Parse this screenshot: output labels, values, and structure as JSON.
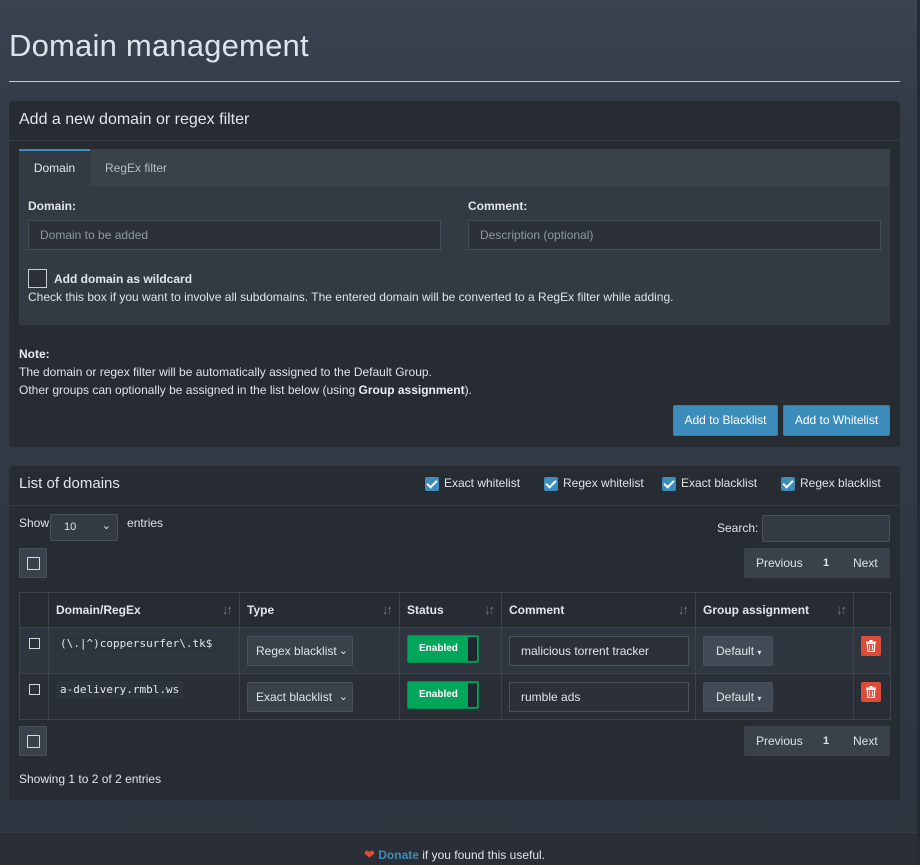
{
  "page": {
    "title": "Domain management"
  },
  "add_box": {
    "title": "Add a new domain or regex filter",
    "tabs": [
      "Domain",
      "RegEx filter"
    ],
    "domain_label": "Domain:",
    "domain_placeholder": "Domain to be added",
    "comment_label": "Comment:",
    "comment_placeholder": "Description (optional)",
    "wildcard_label": "Add domain as wildcard",
    "wildcard_help": "Check this box if you want to involve all subdomains. The entered domain will be converted to a RegEx filter while adding.",
    "note_title": "Note:",
    "note_line1": "The domain or regex filter will be automatically assigned to the Default Group.",
    "note_line2_pre": "Other groups can optionally be assigned in the list below (using ",
    "note_line2_bold": "Group assignment",
    "note_line2_post": ").",
    "btn_blacklist": "Add to Blacklist",
    "btn_whitelist": "Add to Whitelist"
  },
  "list_box": {
    "title": "List of domains",
    "filters": [
      {
        "label": "Exact whitelist",
        "checked": true
      },
      {
        "label": "Regex whitelist",
        "checked": true
      },
      {
        "label": "Exact blacklist",
        "checked": true
      },
      {
        "label": "Regex blacklist",
        "checked": true
      }
    ],
    "show_label": "Show",
    "entries_label": "entries",
    "page_length": "10",
    "search_label": "Search:",
    "pager": {
      "prev": "Previous",
      "page": "1",
      "next": "Next"
    },
    "columns": [
      "Domain/RegEx",
      "Type",
      "Status",
      "Comment",
      "Group assignment"
    ],
    "rows": [
      {
        "domain": "(\\.|^)coppersurfer\\.tk$",
        "type": "Regex blacklist",
        "status": "Enabled",
        "comment": "malicious torrent tracker",
        "group": "Default"
      },
      {
        "domain": "a-delivery.rmbl.ws",
        "type": "Exact blacklist",
        "status": "Enabled",
        "comment": "rumble ads",
        "group": "Default"
      }
    ],
    "showing": "Showing 1 to 2 of 2 entries"
  },
  "footer": {
    "donate": "Donate",
    "suffix": " if you found this useful."
  },
  "colors": {
    "accent": "#3c8dbc",
    "enabled": "#00a65a",
    "danger": "#dd4b39"
  }
}
